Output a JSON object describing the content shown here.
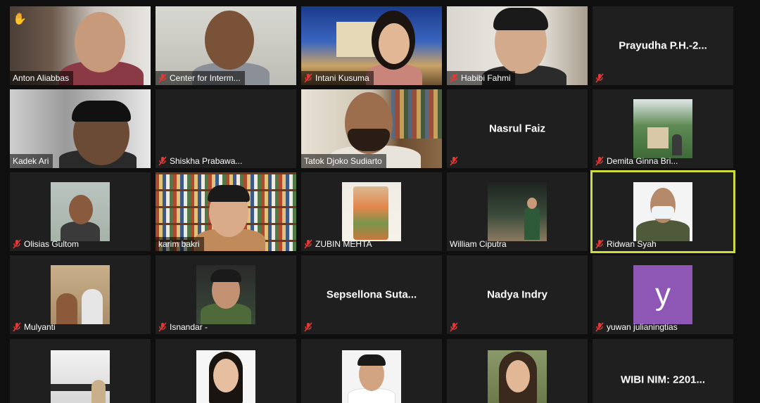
{
  "meeting": {
    "tiles": [
      {
        "name": "Anton Aliabbas",
        "muted": false,
        "hand": true
      },
      {
        "name": "Center for Interm...",
        "muted": true
      },
      {
        "name": "Intani Kusuma",
        "muted": true
      },
      {
        "name": "Habibi Fahmi",
        "muted": true
      },
      {
        "name": "Prayudha  P.H.-2...",
        "muted": true,
        "centered": true
      },
      {
        "name": "Kadek Ari",
        "muted": false
      },
      {
        "name": "Shiskha Prabawa...",
        "muted": true
      },
      {
        "name": "Tatok Djoko Sudiarto",
        "muted": false
      },
      {
        "name": "Nasrul Faiz",
        "muted": true,
        "centered": true
      },
      {
        "name": "Demita Ginna Bri...",
        "muted": true
      },
      {
        "name": "Olisias Gultom",
        "muted": true
      },
      {
        "name": "karim bakri",
        "muted": false
      },
      {
        "name": "ZUBIN MEHTA",
        "muted": true
      },
      {
        "name": "William Ciputra",
        "muted": false
      },
      {
        "name": "Ridwan Syah",
        "muted": true,
        "active": true
      },
      {
        "name": "Mulyanti",
        "muted": true
      },
      {
        "name": "Isnandar -",
        "muted": true
      },
      {
        "name": "Sepsellona  Suta...",
        "muted": true,
        "centered": true
      },
      {
        "name": "Nadya Indry",
        "muted": true,
        "centered": true
      },
      {
        "name": "yuwan julianingtias",
        "muted": true,
        "avatar_letter": "y"
      },
      {
        "name": "",
        "muted": false
      },
      {
        "name": "",
        "muted": false
      },
      {
        "name": "",
        "muted": false
      },
      {
        "name": "",
        "muted": false
      },
      {
        "name": "WIBI NIM: 2201...",
        "muted": false,
        "centered": true
      }
    ]
  },
  "colors": {
    "active_speaker": "#cddc39",
    "tile_bg": "#1f1f1f",
    "muted_icon": "#e53935",
    "avatar_bg": "#8e57b5"
  }
}
